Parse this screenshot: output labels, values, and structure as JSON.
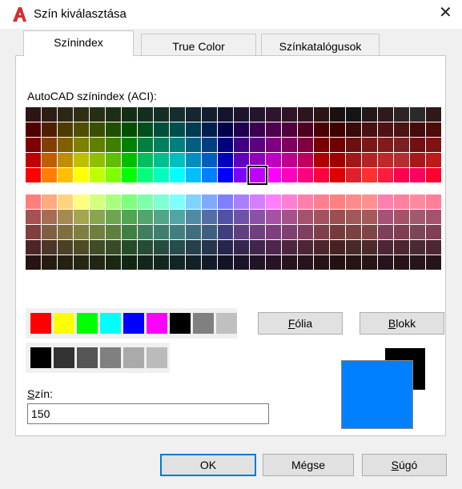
{
  "window": {
    "title": "Szín kiválasztása",
    "close_symbol": "✕",
    "app_icon": "autocad-a-icon",
    "app_icon_color": "#d32f2f"
  },
  "tabs": [
    {
      "label": "Színindex",
      "active": true
    },
    {
      "label": "True Color",
      "active": false
    },
    {
      "label": "Színkatalógusok",
      "active": false
    }
  ],
  "aci_label": "AutoCAD színindex (ACI):",
  "palette_top_rows": [
    [
      "#2e1414",
      "#2e1d14",
      "#2e2614",
      "#2e2e14",
      "#262e14",
      "#1d2e14",
      "#142e14",
      "#142e1d",
      "#142e26",
      "#142e2e",
      "#14262e",
      "#141d2e",
      "#14142e",
      "#1d142e",
      "#26142e",
      "#2e142e",
      "#2e1426",
      "#2e141d",
      "#2a1414",
      "#1a1010",
      "#141414",
      "#231919",
      "#2e1a1a",
      "#2e2424",
      "#2a2a2a",
      "#2e1919"
    ],
    [
      "#4f0000",
      "#4f1f00",
      "#4f3b00",
      "#4f4f00",
      "#3b4f00",
      "#1f4f00",
      "#004f00",
      "#004f1f",
      "#004f3b",
      "#004f4f",
      "#003b4f",
      "#001f4f",
      "#00004f",
      "#1f004f",
      "#3b004f",
      "#4f004f",
      "#4f003b",
      "#4f001f",
      "#4a0000",
      "#3f0000",
      "#3a0a0a",
      "#4a1010",
      "#4f1212",
      "#4a1414",
      "#450a0a",
      "#4f0a0a"
    ],
    [
      "#7f0000",
      "#7f3f00",
      "#7f5f00",
      "#7f7f00",
      "#5f7f00",
      "#3f7f00",
      "#007f00",
      "#007f3f",
      "#007f5f",
      "#007f7f",
      "#005f7f",
      "#003f7f",
      "#00007f",
      "#3f007f",
      "#5f007f",
      "#7f007f",
      "#7f005f",
      "#7f003f",
      "#770000",
      "#6f0000",
      "#6a1010",
      "#7a1818",
      "#7f1b1b",
      "#7a2020",
      "#701010",
      "#7f1212"
    ],
    [
      "#bf0000",
      "#bf5f00",
      "#bf8f00",
      "#bfbf00",
      "#8fbf00",
      "#5fbf00",
      "#00bf00",
      "#00bf5f",
      "#00bf8f",
      "#00bfbf",
      "#008fbf",
      "#005fbf",
      "#0000bf",
      "#5f00bf",
      "#8f00bf",
      "#bf00bf",
      "#bf008f",
      "#bf005f",
      "#b00000",
      "#a00000",
      "#a01818",
      "#b42424",
      "#bf2828",
      "#b43030",
      "#a81818",
      "#bf1a1a"
    ],
    [
      "#ff0000",
      "#ff7f00",
      "#ffbf00",
      "#ffff00",
      "#bfff00",
      "#7fff00",
      "#00ff00",
      "#00ff7f",
      "#00ffbf",
      "#00ffff",
      "#00bfff",
      "#007fff",
      "#0000ff",
      "#7f00ff",
      "#bf00ff",
      "#ff00ff",
      "#ff00bf",
      "#ff007f",
      "#ff0040",
      "#e00000",
      "#e0202a",
      "#ff3030",
      "#ff1a40",
      "#ff0050",
      "#ff0060",
      "#ff0030"
    ]
  ],
  "palette_bottom_rows": [
    [
      "#ff7f7f",
      "#ffaa7f",
      "#ffd47f",
      "#ffff7f",
      "#d4ff7f",
      "#aaff7f",
      "#7fff7f",
      "#7fffaa",
      "#7fffd4",
      "#7fffff",
      "#7fd4ff",
      "#7faaff",
      "#7f7fff",
      "#aa7fff",
      "#d47fff",
      "#ff7fff",
      "#ff7fd4",
      "#ff7faa",
      "#ff7f90",
      "#ff8080",
      "#ff8a8a",
      "#ff9090",
      "#ff7fb0",
      "#ff7fa0",
      "#ff8aa0",
      "#ff7f99"
    ],
    [
      "#a55252",
      "#a56e52",
      "#a58952",
      "#a5a552",
      "#89a552",
      "#6ea552",
      "#52a552",
      "#52a56e",
      "#52a589",
      "#52a5a5",
      "#5289a5",
      "#526ea5",
      "#5252a5",
      "#6e52a5",
      "#8952a5",
      "#a552a5",
      "#a55289",
      "#a5526e",
      "#a55260",
      "#9a5050",
      "#a05858",
      "#a55a5a",
      "#a55278",
      "#a55268",
      "#a05a70",
      "#a55270"
    ],
    [
      "#7f3f3f",
      "#7f5f3f",
      "#7f6f3f",
      "#7f7f3f",
      "#6f7f3f",
      "#5f7f3f",
      "#3f7f3f",
      "#3f7f5f",
      "#3f7f6f",
      "#3f7f7f",
      "#3f6f7f",
      "#3f5f7f",
      "#3f3f7f",
      "#5f3f7f",
      "#6f3f7f",
      "#7f3f7f",
      "#7f3f6f",
      "#7f3f5f",
      "#7f3f4a",
      "#753a3a",
      "#7a4242",
      "#7f4545",
      "#7f3f5a",
      "#7f3f50",
      "#7a4555",
      "#7f3f55"
    ],
    [
      "#4c2626",
      "#4c3626",
      "#4c4026",
      "#4c4c26",
      "#404c26",
      "#364c26",
      "#264c26",
      "#264c36",
      "#264c40",
      "#264c4c",
      "#26404c",
      "#26364c",
      "#26264c",
      "#36264c",
      "#40264c",
      "#4c264c",
      "#4c2640",
      "#4c2636",
      "#4c262d",
      "#462323",
      "#492828",
      "#4c2a2a",
      "#4c2636",
      "#4c2630",
      "#492a33",
      "#4c2633"
    ],
    [
      "#261313",
      "#261b13",
      "#262013",
      "#262613",
      "#202613",
      "#1b2613",
      "#132613",
      "#13261b",
      "#132620",
      "#132626",
      "#132026",
      "#131b26",
      "#131326",
      "#1b1326",
      "#201326",
      "#261326",
      "#261320",
      "#26131b",
      "#261316",
      "#221111",
      "#241414",
      "#261515",
      "#26131b",
      "#261318",
      "#24151a",
      "#26131a"
    ]
  ],
  "selected": {
    "row": 4,
    "col": 14
  },
  "standard_colors": [
    "#ff0000",
    "#ffff00",
    "#00ff00",
    "#00ffff",
    "#0000ff",
    "#ff00ff",
    "#000000",
    "#808080",
    "#c0c0c0"
  ],
  "gray_colors": [
    "#000000",
    "#333333",
    "#555555",
    "#808080",
    "#aaaaaa",
    "#bbbbbb"
  ],
  "buttons": {
    "folia_u": "F",
    "folia_rest": "ólia",
    "blokk_u": "B",
    "blokk_rest": "lokk",
    "ok": "OK",
    "megse": "Mégse",
    "sugo_u": "S",
    "sugo_rest": "úgó"
  },
  "szin_label_u": "S",
  "szin_label_rest": "zín:",
  "szin_value": "150",
  "preview": {
    "old_color": "#000000",
    "new_color": "#0080ff"
  }
}
